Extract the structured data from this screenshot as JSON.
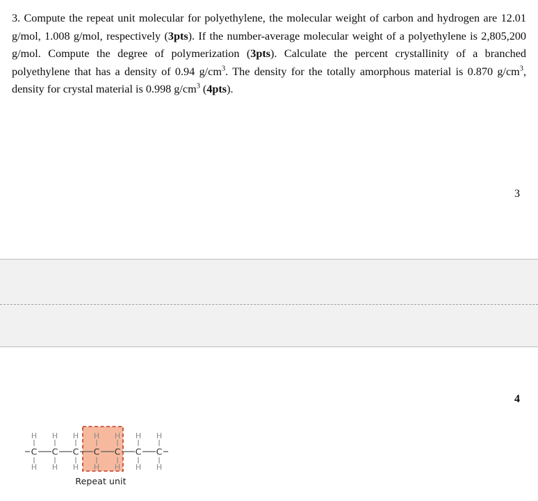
{
  "document": {
    "question": {
      "number": "3.",
      "full_text": "3. Compute the repeat unit molecular for polyethylene, the molecular weight of carbon and hydrogen are 12.01 g/mol, 1.008 g/mol, respectively (3pts). If the number-average molecular weight of a polyethylene is 2,805,200 g/mol. Compute the degree of polymerization (3pts). Calculate the percent crystallinity of a branched polyethylene that has a density of 0.94 g/cm3. The density for the totally amorphous material is 0.870 g/cm3, density for crystal material is 0.998 g/cm3 (4pts).",
      "segments": {
        "s1": "3.  Compute the repeat unit molecular for polyethylene, the molecular weight of carbon and hydrogen are 12.01 g/mol, 1.008 g/mol, respectively (",
        "pts_a": "3pts",
        "s2": "). If the number-average molecular weight of a polyethylene is 2,805,200 g/mol. Compute the degree of polymerization (",
        "pts_b": "3pts",
        "s3": "). Calculate the percent crystallinity of a branched polyethylene that has a density of 0.94 g/cm",
        "sup_a": "3",
        "s4": ". The density for the totally amorphous material is 0.870 g/cm",
        "sup_b": "3",
        "s5": ", density for crystal material is 0.998 g/cm",
        "sup_c": "3",
        "s6": " (",
        "pts_c": "4pts",
        "s7": ")."
      },
      "values": {
        "carbon_molecular_weight": "12.01 g/mol",
        "hydrogen_molecular_weight": "1.008 g/mol",
        "number_average_molecular_weight": "2,805,200 g/mol",
        "branched_density": "0.94 g/cm3",
        "amorphous_density": "0.870 g/cm3",
        "crystal_density": "0.998 g/cm3"
      },
      "point_allocations": [
        "3pts",
        "3pts",
        "4pts"
      ]
    },
    "page_markers": {
      "upper": "3",
      "lower": "4"
    },
    "separator_band": {
      "background_color": "#f1f1f1",
      "border_color": "#b9bcc3",
      "divider_style": "dashed"
    }
  },
  "figure": {
    "name": "polyethylene-chain-diagram",
    "caption": "Repeat unit",
    "highlight_color": "#f7b99e",
    "highlight_border_color": "#c0392b",
    "carbon_label": "C",
    "hydrogen_label": "H",
    "carbon_count": 7,
    "carbon_labels": [
      "C",
      "C",
      "C",
      "C",
      "C",
      "C",
      "C"
    ],
    "hydrogen_top_labels": [
      "H",
      "H",
      "H",
      "H",
      "H",
      "H",
      "H"
    ],
    "hydrogen_bottom_labels": [
      "H",
      "H",
      "H",
      "H",
      "H",
      "H",
      "H"
    ],
    "highlighted_carbon_indices": [
      3,
      4
    ],
    "bond_color": "#555555",
    "hydrogen_text_color": "#8a8a8a",
    "carbon_text_color": "#2b2b2b"
  }
}
